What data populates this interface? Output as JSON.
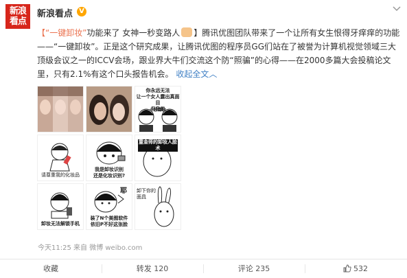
{
  "header": {
    "avatar_line1": "新浪",
    "avatar_line2": "看点",
    "username": "新浪看点",
    "verified_mark": "V"
  },
  "post": {
    "hashtag": "【“一键卸妆”",
    "seg1": "功能来了 女神一秒变路人",
    "seg2": "】腾讯优图团队带来了一个让所有女生恨得牙痒痒的功能——“一键卸妆”。正是这个研究成果，让腾讯优图的程序员GG们站在了被誉为计算机视觉领域三大顶级会议之一的ICCV会场，跟业界大牛们交流这个防“照骗”的心得——在2000多篇大会投稿论文里，只有2.1%有这个口头报告机会。",
    "expand": "收起全文",
    "expand_arrow": "︿"
  },
  "images": {
    "cap_r1c3": "你永远无法\n让一个女人露出真面目\n但我能",
    "cap_r1c3b": "一秒卸妆",
    "cap_r2c1": "请尊重我的化妆品",
    "cap_r2c2": "我是卸妆识别\n还是化妆识别?",
    "cap_r2c3": "童金师的卸妆人脸术",
    "cap_r3c1": "卸妆无法解锁手机",
    "cap_r3c2": "装了N个美图软件\n依旧P不好这张脸",
    "cap_r3c2b": "耶",
    "cap_r3c3": "卸下你的\n面具"
  },
  "meta": {
    "time": "今天11:25",
    "source_prefix": "来自",
    "source": "微博 weibo.com"
  },
  "footer": {
    "collect": "收藏",
    "repost": "转发 120",
    "comment": "评论 235",
    "like": "532"
  },
  "colors": {
    "brand_red": "#d7261b",
    "link_blue": "#3f7fc4",
    "highlight_orange": "#eb7350",
    "muted": "#999999"
  }
}
